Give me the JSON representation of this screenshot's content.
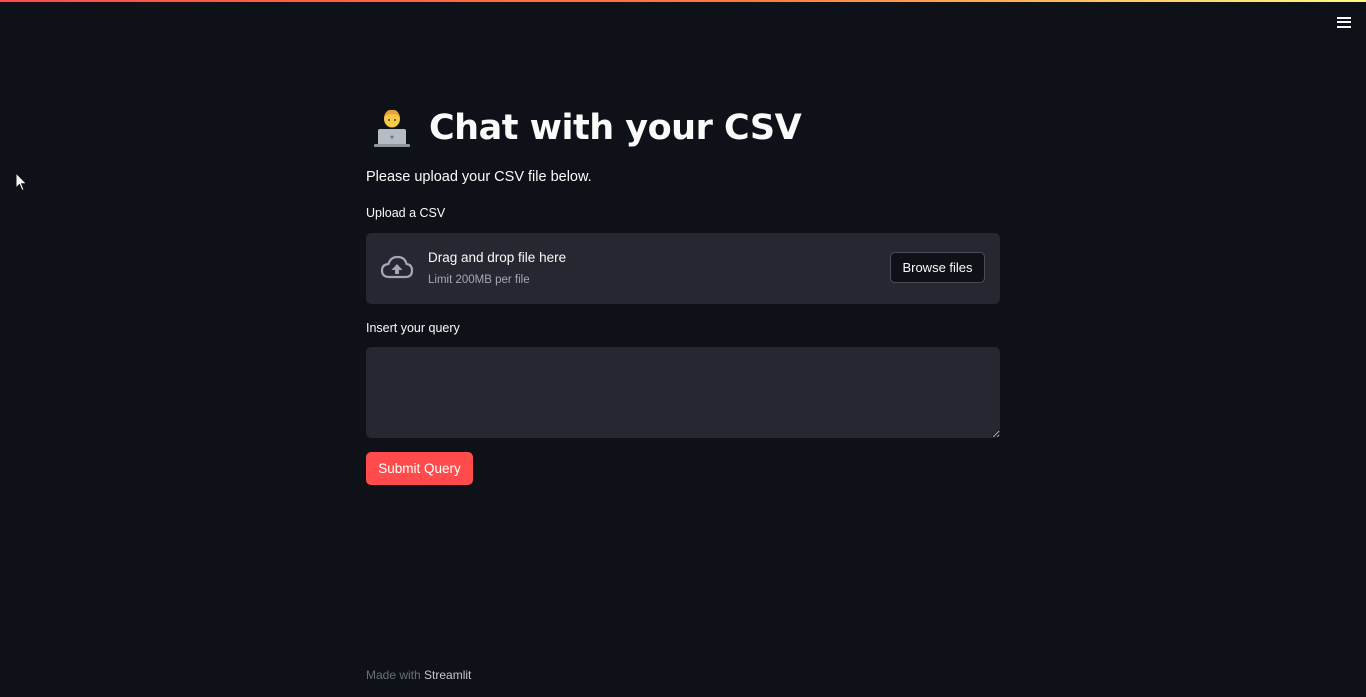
{
  "header": {
    "menu_icon": "hamburger-icon"
  },
  "page": {
    "title_emoji": "technologist-emoji",
    "title": "Chat with your CSV",
    "subtitle": "Please upload your CSV file below."
  },
  "uploader": {
    "label": "Upload a CSV",
    "icon": "cloud-upload-icon",
    "drop_title": "Drag and drop file here",
    "limit_text": "Limit 200MB per file",
    "browse_label": "Browse files"
  },
  "query": {
    "label": "Insert your query",
    "value": "",
    "submit_label": "Submit Query"
  },
  "footer": {
    "prefix": "Made with ",
    "link": "Streamlit"
  },
  "colors": {
    "background": "#0e1117",
    "input_bg": "#262730",
    "accent": "#ff4b4b",
    "text": "#fafafa"
  }
}
